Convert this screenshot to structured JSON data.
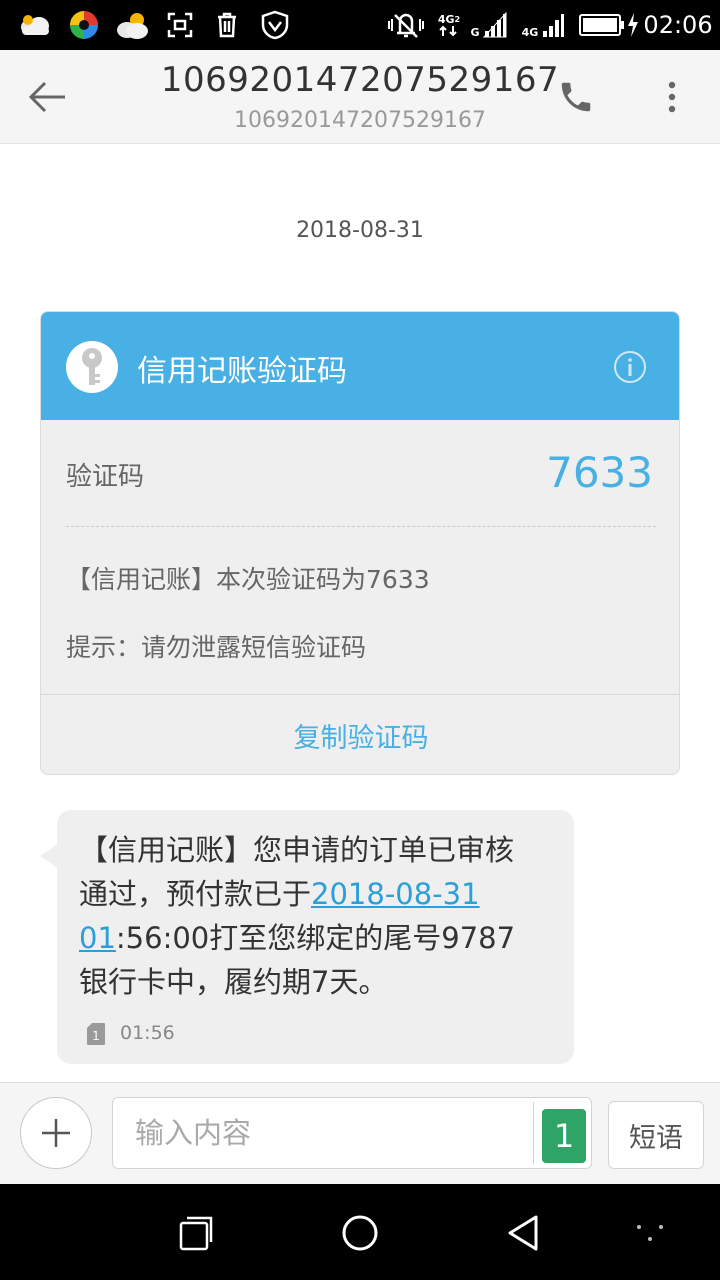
{
  "status_bar": {
    "time": "02:06",
    "network1_label": "4G",
    "network1_sub": "2",
    "network2_label": "4G",
    "network_g": "G",
    "icons": [
      "weather-icon",
      "colorful-app-icon",
      "weather-sun-icon",
      "screenshot-icon",
      "trash-icon",
      "shield-icon",
      "mute-icon",
      "signal-icon",
      "battery-icon",
      "charging-icon"
    ]
  },
  "header": {
    "title": "10692014720752916​7",
    "subtitle": "10692014720752916​7"
  },
  "thread": {
    "date": "2018-08-31"
  },
  "verification_card": {
    "title": "信用记账验证码",
    "code_label": "验证码",
    "code_value": "7633",
    "message_line1": "【信用记账】本次验证码为7633",
    "message_line2": "提示：请勿泄露短信验证码",
    "copy_label": "复制验证码",
    "header_color": "#48b0e4"
  },
  "message": {
    "text_part1": "【信用记账】您申请的订单已审核通过，预付款已于",
    "link_text": "2018-08-31 01",
    "text_part2": ":56:00打至您绑定的尾号9787银行卡中，履约期7天。",
    "sim": "1",
    "time": "01:56"
  },
  "composer": {
    "placeholder": "输入内容",
    "sim_label": "1",
    "phrases_label": "短语",
    "sim_color": "#2ea466"
  }
}
